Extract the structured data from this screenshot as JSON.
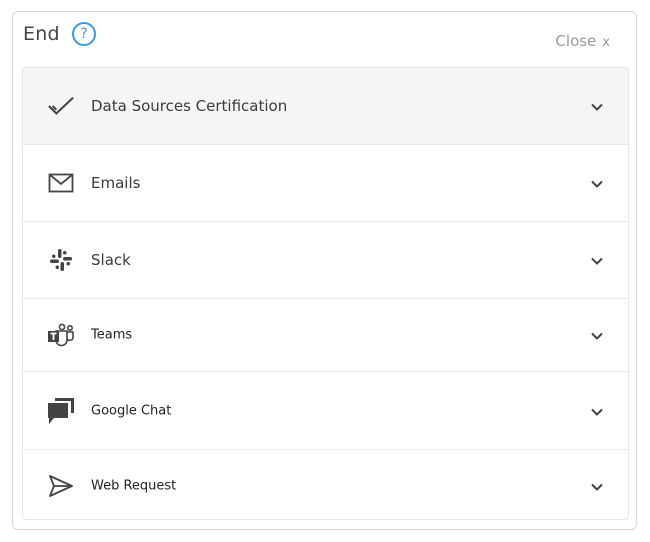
{
  "header": {
    "title": "End",
    "help_icon": "?",
    "close_label": "Close",
    "close_x": "x"
  },
  "accent": "#3a9bd9",
  "items": [
    {
      "label": "Data Sources Certification",
      "icon": "checkmark-icon"
    },
    {
      "label": "Emails",
      "icon": "envelope-icon"
    },
    {
      "label": "Slack",
      "icon": "slack-icon"
    },
    {
      "label": "Teams",
      "icon": "teams-icon"
    },
    {
      "label": "Google Chat",
      "icon": "chat-bubbles-icon"
    },
    {
      "label": "Web Request",
      "icon": "paper-plane-icon"
    }
  ]
}
